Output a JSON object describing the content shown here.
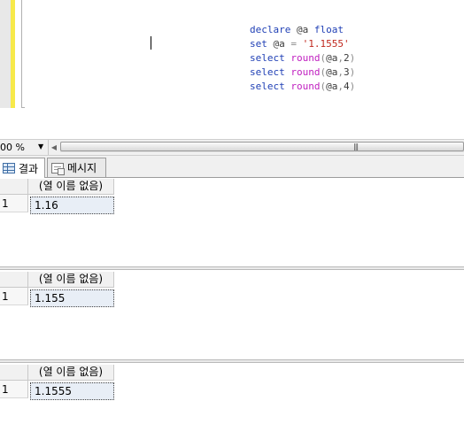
{
  "editor": {
    "code_lines": [
      [
        {
          "t": "declare ",
          "c": "kw"
        },
        {
          "t": "@a ",
          "c": "id"
        },
        {
          "t": "float",
          "c": "kw"
        }
      ],
      [
        {
          "t": "set ",
          "c": "kw"
        },
        {
          "t": "@a ",
          "c": "id"
        },
        {
          "t": "= ",
          "c": "op"
        },
        {
          "t": "'1.1555'",
          "c": "str"
        }
      ],
      [
        {
          "t": "select ",
          "c": "kw"
        },
        {
          "t": "round",
          "c": "fn"
        },
        {
          "t": "(",
          "c": "op"
        },
        {
          "t": "@a",
          "c": "id"
        },
        {
          "t": ",",
          "c": "op"
        },
        {
          "t": "2",
          "c": "id"
        },
        {
          "t": ")",
          "c": "op"
        }
      ],
      [
        {
          "t": "select ",
          "c": "kw"
        },
        {
          "t": "round",
          "c": "fn"
        },
        {
          "t": "(",
          "c": "op"
        },
        {
          "t": "@a",
          "c": "id"
        },
        {
          "t": ",",
          "c": "op"
        },
        {
          "t": "3",
          "c": "id"
        },
        {
          "t": ")",
          "c": "op"
        }
      ],
      [
        {
          "t": "select ",
          "c": "kw"
        },
        {
          "t": "round",
          "c": "fn"
        },
        {
          "t": "(",
          "c": "op"
        },
        {
          "t": "@a",
          "c": "id"
        },
        {
          "t": ",",
          "c": "op"
        },
        {
          "t": "4",
          "c": "id"
        },
        {
          "t": ")",
          "c": "op"
        }
      ]
    ]
  },
  "zoom": {
    "value": "00 %",
    "arrow": "▼"
  },
  "scrollbar": {
    "left_arrow": "◀",
    "grip": "|||"
  },
  "tabs": {
    "results_label": "결과",
    "messages_label": "메시지"
  },
  "results": [
    {
      "column_header": "(열 이름 없음)",
      "row_number": "1",
      "value": "1.16"
    },
    {
      "column_header": "(열 이름 없음)",
      "row_number": "1",
      "value": "1.155"
    },
    {
      "column_header": "(열 이름 없음)",
      "row_number": "1",
      "value": "1.1555"
    }
  ]
}
